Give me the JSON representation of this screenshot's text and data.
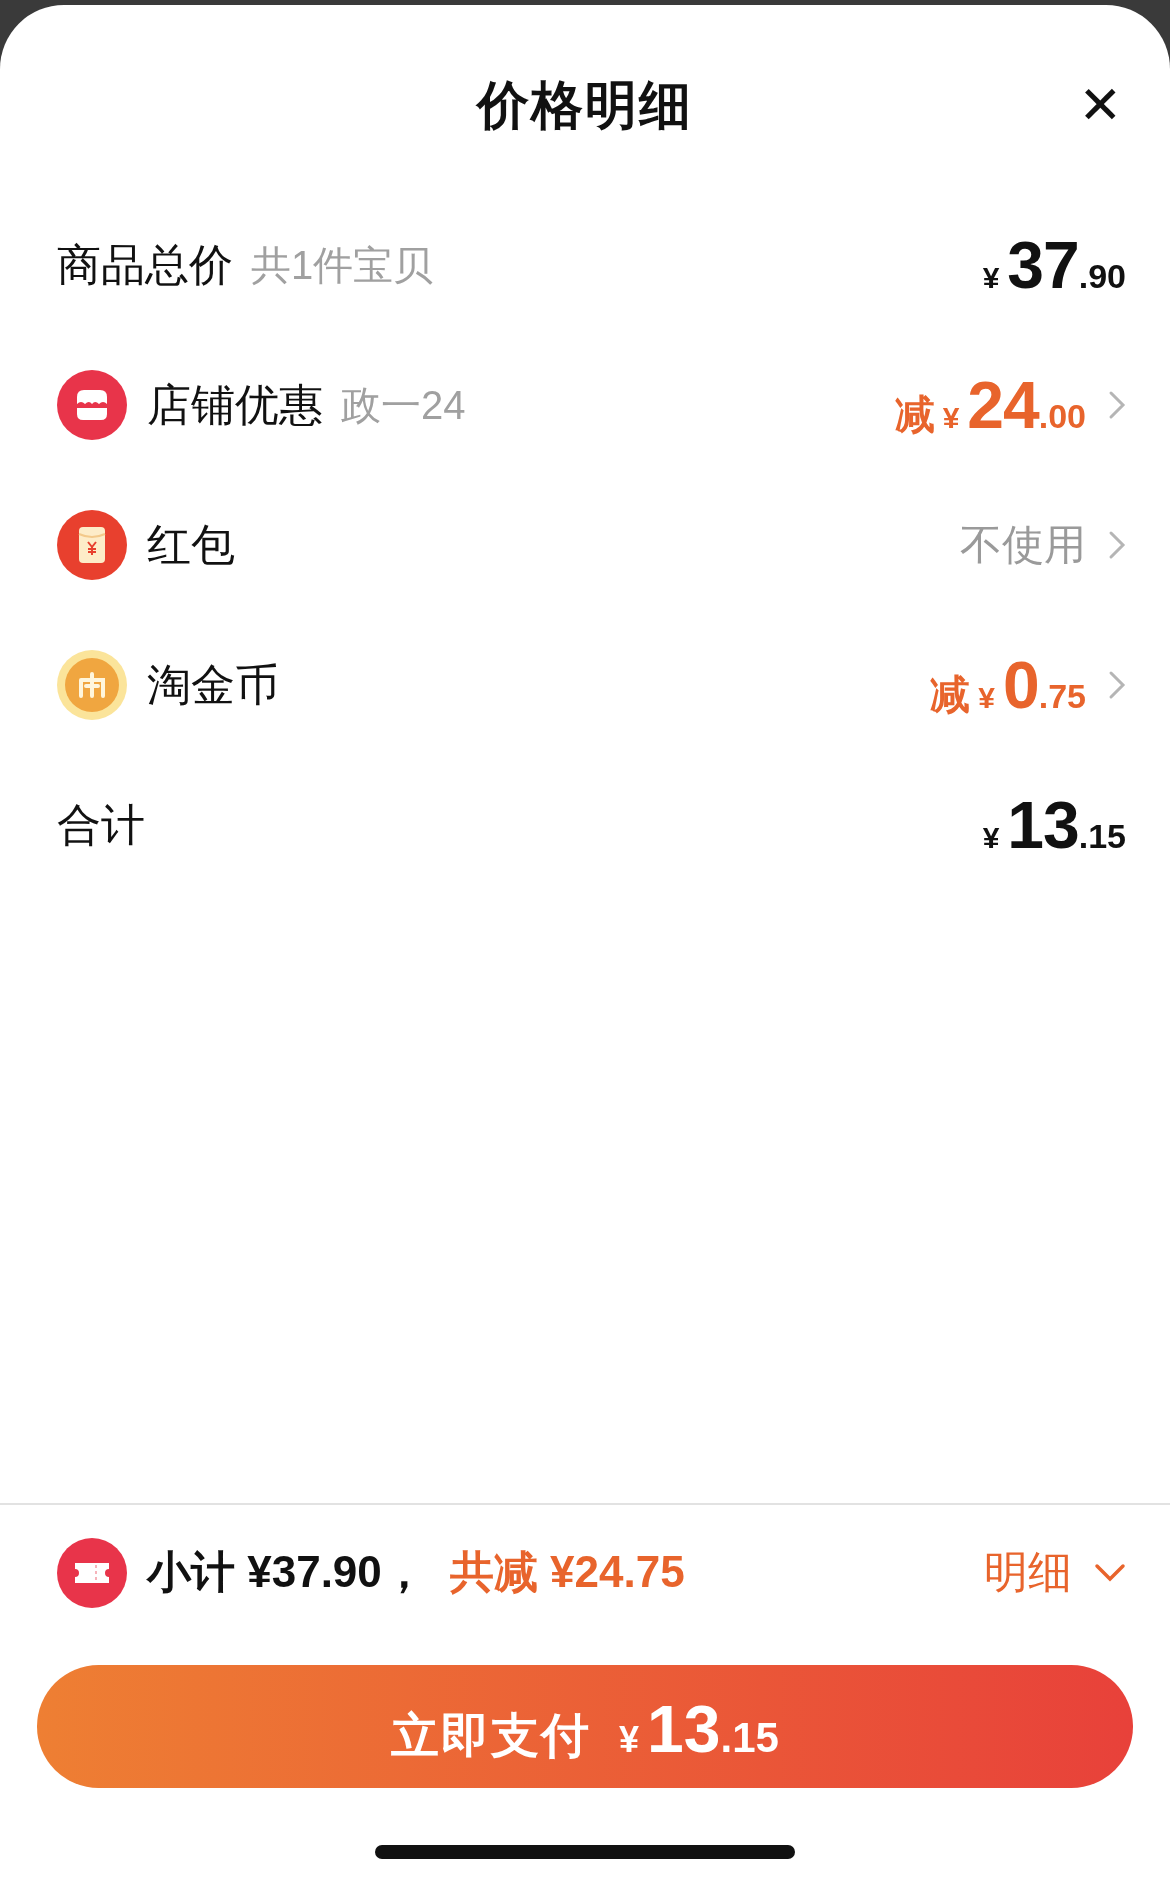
{
  "sheet": {
    "title": "价格明细",
    "close": "✕"
  },
  "rows": [
    {
      "kind": "summary",
      "label": "商品总价",
      "note": "共1件宝贝",
      "value": {
        "kind": "plain",
        "currency": "¥",
        "integer": "37",
        "fraction": ".90"
      }
    },
    {
      "kind": "store",
      "label": "店铺优惠",
      "note": "政一24",
      "value": {
        "kind": "discount",
        "prefix": "减",
        "currency": "¥",
        "integer": "24",
        "fraction": ".00"
      }
    },
    {
      "kind": "envelope",
      "label": "红包",
      "value": {
        "kind": "muted",
        "text": "不使用"
      }
    },
    {
      "kind": "coin",
      "label": "淘金币",
      "value": {
        "kind": "discount",
        "prefix": "减",
        "currency": "¥",
        "integer": "0",
        "fraction": ".75"
      }
    },
    {
      "kind": "summary",
      "label": "合计",
      "value": {
        "kind": "plain",
        "currency": "¥",
        "integer": "13",
        "fraction": ".15"
      }
    }
  ],
  "footer": {
    "subtotal": "小计 ¥37.90，",
    "saved": "共减 ¥24.75",
    "details_link": "明细",
    "pay_button": {
      "label": "立即支付",
      "currency": "¥",
      "integer": "13",
      "fraction": ".15"
    }
  }
}
